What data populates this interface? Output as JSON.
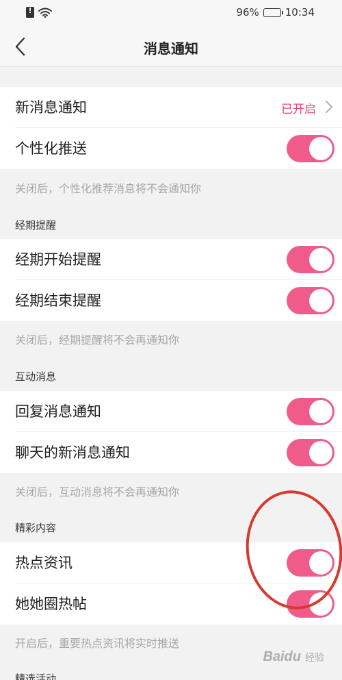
{
  "status_bar": {
    "battery_percent": "96%",
    "time": "10:34",
    "battery_level": 0.96
  },
  "nav": {
    "title": "消息通知",
    "back_icon": "chevron-left-icon"
  },
  "rows": {
    "new_message": {
      "label": "新消息通知",
      "status": "已开启"
    },
    "personalized_push": {
      "label": "个性化推送",
      "enabled": true
    },
    "period_start": {
      "label": "经期开始提醒",
      "enabled": true
    },
    "period_end": {
      "label": "经期结束提醒",
      "enabled": true
    },
    "reply_message": {
      "label": "回复消息通知",
      "enabled": true
    },
    "chat_message": {
      "label": "聊天的新消息通知",
      "enabled": true
    },
    "hot_news": {
      "label": "热点资讯",
      "enabled": true
    },
    "tata_circle": {
      "label": "她她圈热帖",
      "enabled": true
    }
  },
  "notes": {
    "personalized": "关闭后，个性化推荐消息将不会通知你",
    "period": "关闭后，经期提醒将不会再通知你",
    "interaction": "关闭后，互动消息将不会再通知你",
    "highlights": "开启后，重要热点资讯将实时推送"
  },
  "sections": {
    "period": "经期提醒",
    "interaction": "互动消息",
    "highlights": "精彩内容",
    "selected_events": "精选活动"
  },
  "watermark": {
    "brand": "Baidu",
    "sub": "经验"
  },
  "colors": {
    "accent": "#f05b8c",
    "status_text": "#e8457a",
    "annotation": "#d63a2e"
  }
}
